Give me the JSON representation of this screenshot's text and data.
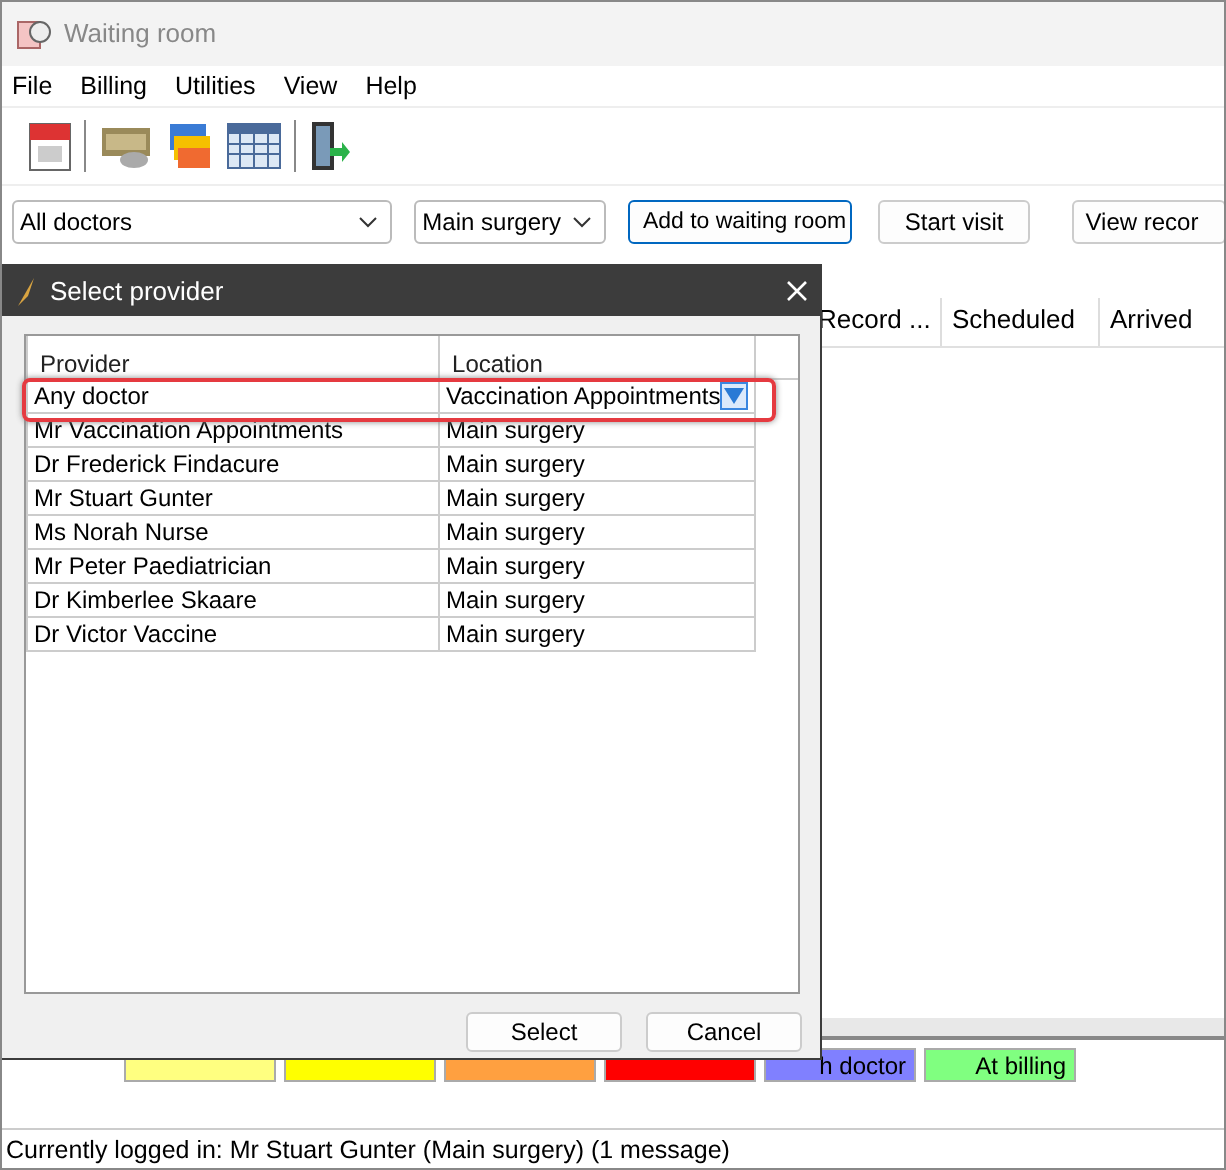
{
  "window": {
    "title": "Waiting room"
  },
  "menu": [
    "File",
    "Billing",
    "Utilities",
    "View",
    "Help"
  ],
  "filters": {
    "doctor": "All doctors",
    "location": "Main surgery"
  },
  "buttons": [
    {
      "label": "Add to waiting room",
      "focused": true
    },
    {
      "label": "Start visit",
      "focused": false
    },
    {
      "label": "View recor",
      "focused": false
    }
  ],
  "table": {
    "columns": [
      "Record ...",
      "Scheduled",
      "Arrived"
    ]
  },
  "legend": [
    {
      "color": "#ffff80"
    },
    {
      "color": "#ffff00"
    },
    {
      "color": "#ffa040"
    },
    {
      "color": "#ff0000"
    },
    {
      "color": "#8080ff",
      "label": "h doctor"
    },
    {
      "color": "#80ff80",
      "label": "At billing"
    }
  ],
  "status_bar": "Currently logged in:  Mr Stuart Gunter (Main surgery) (1 message)",
  "dialog": {
    "title": "Select provider",
    "columns": [
      "Provider",
      "Location"
    ],
    "rows": [
      {
        "provider": "Any doctor",
        "location": "Vaccination Appointments",
        "highlighted": true
      },
      {
        "provider": "Mr Vaccination Appointments",
        "location": "Main surgery",
        "highlighted": false
      },
      {
        "provider": "Dr Frederick Findacure",
        "location": "Main surgery",
        "highlighted": false
      },
      {
        "provider": "Mr Stuart Gunter",
        "location": "Main surgery",
        "highlighted": false
      },
      {
        "provider": "Ms Norah Nurse",
        "location": "Main surgery",
        "highlighted": false
      },
      {
        "provider": "Mr Peter Paediatrician",
        "location": "Main surgery",
        "highlighted": false
      },
      {
        "provider": "Dr Kimberlee Skaare",
        "location": "Main surgery",
        "highlighted": false
      },
      {
        "provider": "Dr Victor Vaccine",
        "location": "Main surgery",
        "highlighted": false
      }
    ],
    "buttons": [
      "Select",
      "Cancel"
    ]
  }
}
